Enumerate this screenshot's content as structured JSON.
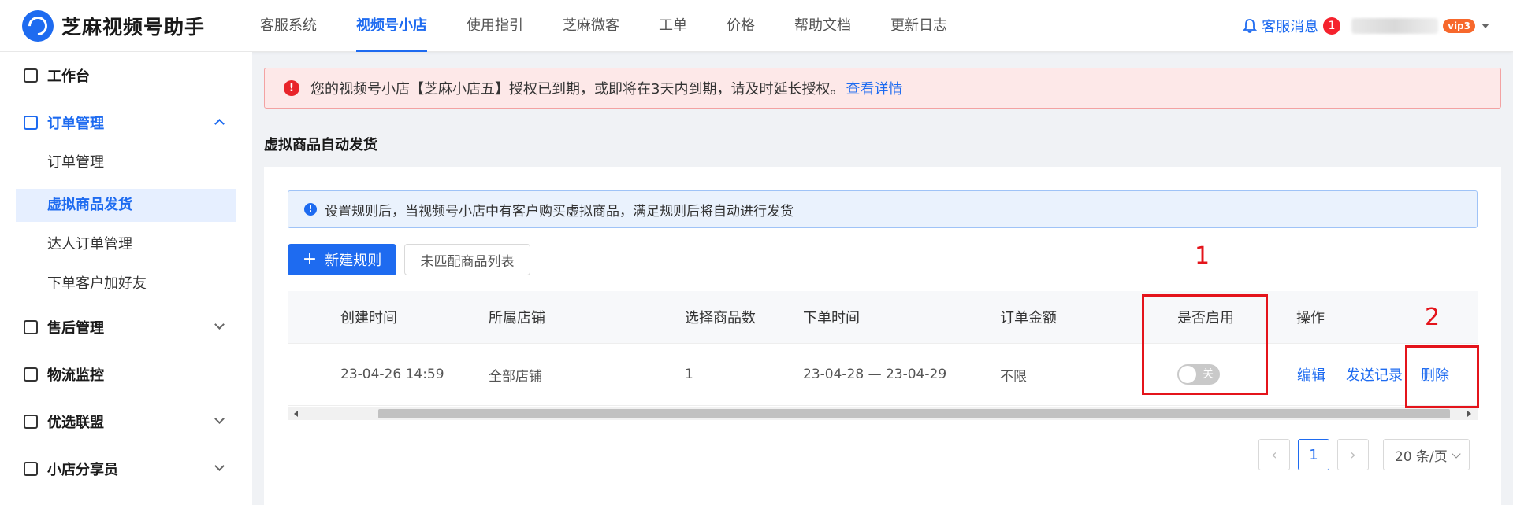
{
  "brand": {
    "name": "芝麻视频号助手",
    "logo_icon": "chat-bubble-icon"
  },
  "topnav": {
    "items": [
      "客服系统",
      "视频号小店",
      "使用指引",
      "芝麻微客",
      "工单",
      "价格",
      "帮助文档",
      "更新日志"
    ],
    "active_index": 1
  },
  "header_right": {
    "message_label": "客服消息",
    "message_count": "1",
    "vip_label": "vip3"
  },
  "sidebar": {
    "workbench": "工作台",
    "order_mgmt": "订单管理",
    "order_children": [
      "订单管理",
      "虚拟商品发货",
      "达人订单管理",
      "下单客户加好友"
    ],
    "active_child_index": 1,
    "after_sales": "售后管理",
    "logistics": "物流监控",
    "alliance": "优选联盟",
    "sharer": "小店分享员"
  },
  "alert": {
    "text": "您的视频号小店【芝麻小店五】授权已到期，或即将在3天内到期，请及时延长授权。",
    "link": "查看详情",
    "color": "#e8242a"
  },
  "page": {
    "title": "虚拟商品自动发货"
  },
  "info": {
    "text": "设置规则后，当视频号小店中有客户购买虚拟商品，满足规则后将自动进行发货"
  },
  "actions": {
    "new_rule": "新建规则",
    "unmatched_list": "未匹配商品列表"
  },
  "table": {
    "headers": [
      "创建时间",
      "所属店铺",
      "选择商品数",
      "下单时间",
      "订单金额",
      "是否启用",
      "操作"
    ],
    "rows": [
      {
        "created": "23-04-26 14:59",
        "shop": "全部店铺",
        "count": "1",
        "order_time": "23-04-28 — 23-04-29",
        "amount": "不限",
        "enabled_label": "关",
        "ops": [
          "编辑",
          "发送记录",
          "删除"
        ]
      }
    ]
  },
  "annotations": [
    "1",
    "2"
  ],
  "pagination": {
    "current_page": "1",
    "page_size": "20 条/页"
  },
  "colors": {
    "accent": "#1e6bf0",
    "annotation": "#e4141b"
  }
}
